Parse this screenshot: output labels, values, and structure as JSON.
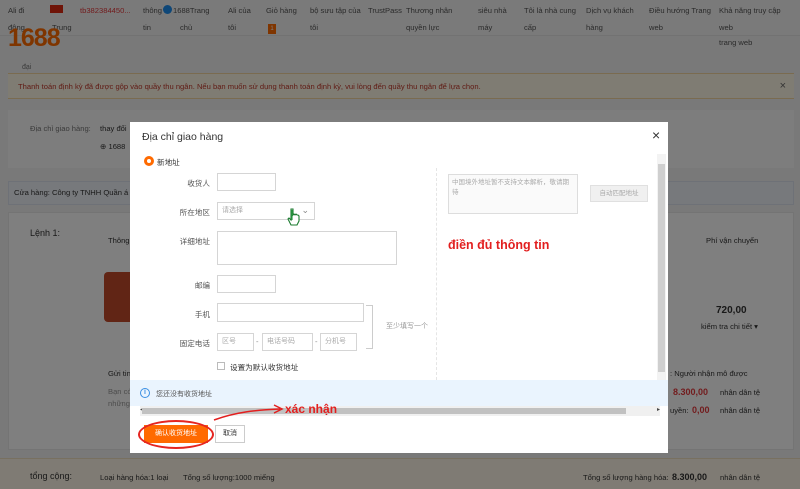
{
  "topnav": {
    "items": [
      {
        "label": "Ali đi",
        "red": false
      },
      {
        "label": "tb382384450...",
        "red": true
      },
      {
        "label": "thông",
        "red": false
      },
      {
        "label": "1688Trang",
        "red": false
      },
      {
        "label": "Ali của",
        "red": false
      },
      {
        "label": "Giỏ hàng",
        "red": false
      },
      {
        "label": "bộ sưu tập của",
        "red": false
      },
      {
        "label": "TrustPass",
        "red": false
      },
      {
        "label": "Thương nhân",
        "red": false
      },
      {
        "label": "siêu nhà",
        "red": false
      },
      {
        "label": "Tôi là nhà cung",
        "red": false
      },
      {
        "label": "Dịch vụ khách",
        "red": false
      },
      {
        "label": "Điều hướng Trang",
        "red": false
      },
      {
        "label": "Khả năng truy cập",
        "red": false
      }
    ],
    "row2": [
      {
        "label": "động"
      },
      {
        "label": "Trung"
      },
      {
        "label": "tin"
      },
      {
        "label": "chủ"
      },
      {
        "label": "tôi"
      },
      {
        "label": "tôi"
      },
      {
        "label": "quyền lực"
      },
      {
        "label": "máy"
      },
      {
        "label": "cấp"
      },
      {
        "label": "hàng"
      },
      {
        "label": "web"
      },
      {
        "label": "web"
      }
    ],
    "cart_count": "1",
    "logo": "1688",
    "logo_sub": "đại",
    "extra": "trang web"
  },
  "notice": {
    "text": "Thanh toán định kỳ đã được gộp vào quầy thu ngân. Nếu bạn muốn sử dụng thanh toán định kỳ, vui lòng đến quầy thu ngân để lựa chọn.",
    "close": "×"
  },
  "background": {
    "addr_label": "Địa chỉ giao hàng:",
    "addr_change": "thay đổi",
    "addr_1688": "1688",
    "shop_label": "Cửa hàng: Công ty TNHH Quần á",
    "order_label": "Lệnh 1:",
    "col_thong": "Thông",
    "col_shipping": "Phí vận chuyển",
    "shipping_value": "720,00",
    "check_detail": "kiểm tra chi tiết",
    "send_label": "Gửi tin",
    "ban_label": "Bạn có",
    "nhung_label": "những",
    "recipient_pays": "Người nhận mô được",
    "amount1": "8.300,00",
    "amount1_unit": "nhân dân tệ",
    "amount2": "0,00",
    "amount2_unit": "nhân dân tệ",
    "uyen": "uyền:",
    "total_label": "tổng cộng:",
    "goods_type": "Loại hàng hóa:1 loại",
    "total_qty": "Tổng số lượng:1000 miếng",
    "total_goods_label": "Tổng số lượng hàng hóa:",
    "total_goods_value": "8.300,00",
    "total_goods_unit": "nhân dân tệ"
  },
  "modal": {
    "title": "Địa chỉ giao hàng",
    "close": "×",
    "new_address": "新地址",
    "fields": {
      "recipient_label": "收货人",
      "region_label": "所在地区",
      "region_placeholder": "请选择",
      "detail_label": "详细地址",
      "postcode_label": "邮编",
      "phone_label": "手机",
      "landline_label": "固定电话",
      "area_code_placeholder": "区号",
      "tel_placeholder": "电话号码",
      "ext_placeholder": "分机号",
      "dash": "-",
      "atleast_one": "至少填写一个",
      "default_addr": "设置为默认收货地址"
    },
    "hint_text": "中国境外地址暂不支持文本解析，敬请期待",
    "auto_match": "自动匹配地址",
    "info_text": "您还没有收货地址",
    "confirm": "确认收货地址",
    "cancel": "取消"
  },
  "annotations": {
    "fill_info": "điền đủ thông tin",
    "confirm_note": "xác nhận"
  },
  "colors": {
    "brand_orange": "#ff6a00",
    "annotation_red": "#e21f1f"
  }
}
